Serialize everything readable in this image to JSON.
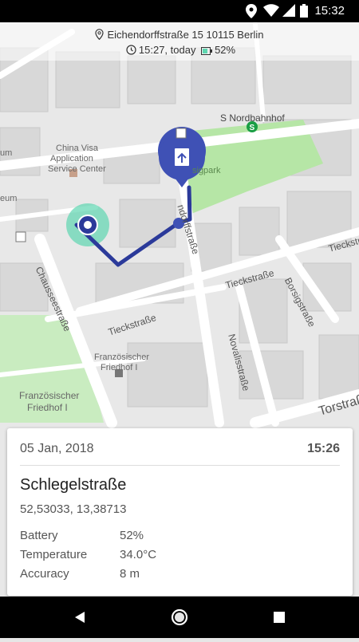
{
  "status_bar": {
    "time": "15:32",
    "icons": [
      "location-icon",
      "wifi-icon",
      "signal-icon",
      "battery-icon"
    ]
  },
  "header": {
    "address": "Eichendorffstraße 15 10115 Berlin",
    "time": "15:27, today",
    "battery": "52%"
  },
  "map": {
    "labels": {
      "s_nordbahnhof": "S Nordbahnhof",
      "china_visa": "China Visa",
      "application": "Application",
      "service_center": "Service Center",
      "um": "um",
      "eum": "eum",
      "park": "sigpark",
      "chausseestrasse": "Chausseestraße",
      "tieckstrasse_1": "Tieckstraße",
      "tieckstrasse_2": "Tieckstraße",
      "tieckstrasse_3": "Tieckstr",
      "novalisstrasse": "Novalisstraße",
      "borsigstrasse": "Borsigstraße",
      "torstrasse": "Torstraße",
      "ndorffstrasse": "ndorffstraße",
      "franz_friedhof_1a": "Französischer",
      "franz_friedhof_1b": "Friedhof I",
      "franz_friedhof_2a": "Französischer",
      "franz_friedhof_2b": "Friedhof I"
    },
    "colors": {
      "route": "#2b3a9a",
      "marker": "#3f51b5",
      "accuracy_circle": "#5ed6b0",
      "park": "#b6e6a6",
      "building": "#d6d6d6",
      "road": "#ffffff"
    }
  },
  "card": {
    "date": "05 Jan, 2018",
    "time": "15:26",
    "street": "Schlegelstraße",
    "coordinates": "52,53033, 13,38713",
    "details": [
      {
        "label": "Battery",
        "value": "52%"
      },
      {
        "label": "Temperature",
        "value": "34.0°C"
      },
      {
        "label": "Accuracy",
        "value": "8 m"
      }
    ]
  },
  "nav": {
    "buttons": [
      "back-icon",
      "home-icon",
      "recents-icon"
    ]
  }
}
